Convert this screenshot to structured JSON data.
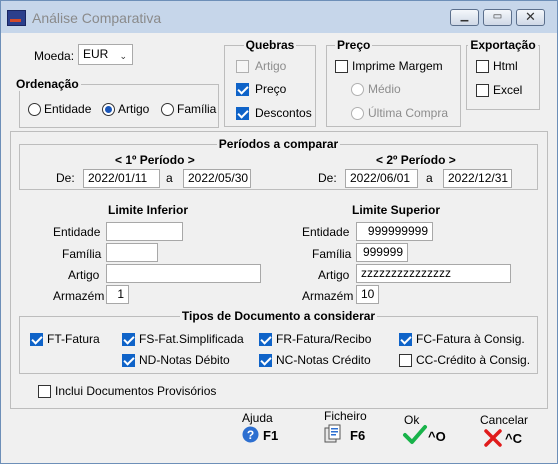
{
  "window": {
    "title": "Análise Comparativa"
  },
  "moeda": {
    "label": "Moeda:",
    "value": "EUR"
  },
  "ordenacao": {
    "title": "Ordenação",
    "options": [
      "Entidade",
      "Artigo",
      "Família"
    ],
    "selected": "Artigo"
  },
  "quebras": {
    "title": "Quebras",
    "items": [
      {
        "label": "Artigo",
        "checked": false,
        "enabled": false
      },
      {
        "label": "Preço",
        "checked": true,
        "enabled": true
      },
      {
        "label": "Descontos",
        "checked": true,
        "enabled": true
      }
    ]
  },
  "preco": {
    "title": "Preço",
    "imprime_margem": {
      "label": "Imprime Margem",
      "checked": false
    },
    "options": [
      {
        "label": "Médio",
        "enabled": false
      },
      {
        "label": "Última Compra",
        "enabled": false
      }
    ]
  },
  "exportacao": {
    "title": "Exportação",
    "items": [
      {
        "label": "Html",
        "checked": false
      },
      {
        "label": "Excel",
        "checked": false
      }
    ]
  },
  "periodos": {
    "title": "Períodos a comparar",
    "p1": {
      "title": "< 1º Período >",
      "de_label": "De:",
      "de": "2022/01/11",
      "a_label": "a",
      "a": "2022/05/30"
    },
    "p2": {
      "title": "< 2º Período >",
      "de_label": "De:",
      "de": "2022/06/01",
      "a_label": "a",
      "a": "2022/12/31"
    },
    "limite_inferior": {
      "title": "Limite Inferior",
      "entidade": "",
      "familia": "",
      "artigo": "",
      "armazem": "1"
    },
    "limite_superior": {
      "title": "Limite Superior",
      "entidade": "999999999",
      "familia": "999999",
      "artigo": "zzzzzzzzzzzzzzz",
      "armazem": "10"
    },
    "labels": {
      "entidade": "Entidade",
      "familia": "Família",
      "artigo": "Artigo",
      "armazem": "Armazém"
    }
  },
  "tipos": {
    "title": "Tipos de Documento a considerar",
    "items": [
      {
        "label": "FT-Fatura",
        "checked": true
      },
      {
        "label": "FS-Fat.Simplificada",
        "checked": true
      },
      {
        "label": "FR-Fatura/Recibo",
        "checked": true
      },
      {
        "label": "FC-Fatura à Consig.",
        "checked": true
      },
      {
        "label": "ND-Notas Débito",
        "checked": true
      },
      {
        "label": "NC-Notas Crédito",
        "checked": true
      },
      {
        "label": "CC-Crédito à Consig.",
        "checked": false
      }
    ]
  },
  "provisorios": {
    "label": "Inclui Documentos Provisórios",
    "checked": false
  },
  "footer": {
    "ajuda": {
      "caption": "Ajuda",
      "key": "F1",
      "icon": "help-icon"
    },
    "ficheiro": {
      "caption": "Ficheiro",
      "key": "F6",
      "icon": "file-icon"
    },
    "ok": {
      "caption": "Ok",
      "key": "^O",
      "icon": "checkmark-icon",
      "color": "#18b34a"
    },
    "cancelar": {
      "caption": "Cancelar",
      "key": "^C",
      "icon": "cross-icon",
      "color": "#e01b1b"
    }
  }
}
